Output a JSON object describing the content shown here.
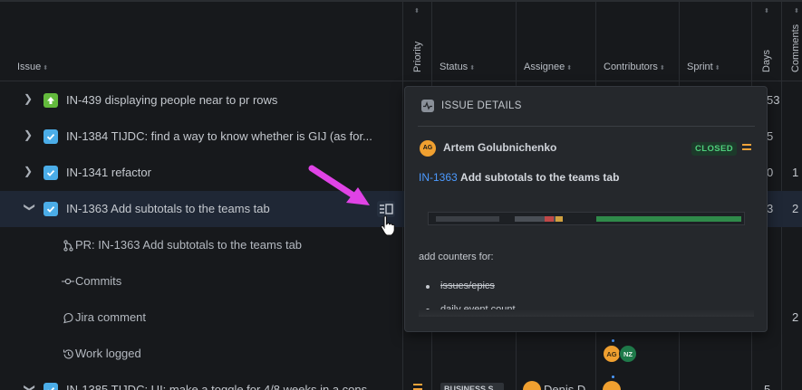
{
  "header": {
    "issue": "Issue",
    "priority": "Priority",
    "status": "Status",
    "assignee": "Assignee",
    "contributors": "Contributors",
    "sprint": "Sprint",
    "days": "Days",
    "comments": "Comments"
  },
  "rows": [
    {
      "key_title": "IN-439 displaying people near to pr rows",
      "type": "story",
      "days": "53",
      "comments": ""
    },
    {
      "key_title": "IN-1384 TIJDC: find a way to know whether is GIJ (as for...",
      "type": "task",
      "days": "5",
      "comments": ""
    },
    {
      "key_title": "IN-1341 refactor",
      "type": "task",
      "days": "0",
      "comments": "1"
    },
    {
      "key_title": "IN-1363 Add subtotals to the teams tab",
      "type": "task",
      "days": "3",
      "comments": "2"
    }
  ],
  "subrows": [
    {
      "label": "PR: IN-1363 Add subtotals to the teams tab",
      "icon": "pull-request-icon"
    },
    {
      "label": "Commits",
      "icon": "commit-icon"
    },
    {
      "label": "Jira comment",
      "icon": "comment-icon"
    },
    {
      "label": "Work logged",
      "icon": "history-icon"
    }
  ],
  "subrow_comments": "2",
  "last_row": {
    "key_title": "IN-1385 TIJDC: UI: make a toggle for 4/8 weeks in a cons...",
    "status": "BUSINESS S...",
    "assignee": "Denis D...",
    "days": "5"
  },
  "contributors": {
    "work_logged": [
      "AG",
      "NZ"
    ]
  },
  "popup": {
    "title": "ISSUE DETAILS",
    "author": "Artem Golubnichenko",
    "author_initials": "AG",
    "status": "CLOSED",
    "issue_key": "IN-1363",
    "issue_title": "Add subtotals to the teams tab",
    "description": "add counters for:",
    "bullets": [
      "issues/epics",
      "daily event count"
    ]
  },
  "colors": {
    "accent": "#4c9aff",
    "closed": "#4fcf7c",
    "priority": "#f2a33a",
    "arrow": "#e043e6"
  }
}
